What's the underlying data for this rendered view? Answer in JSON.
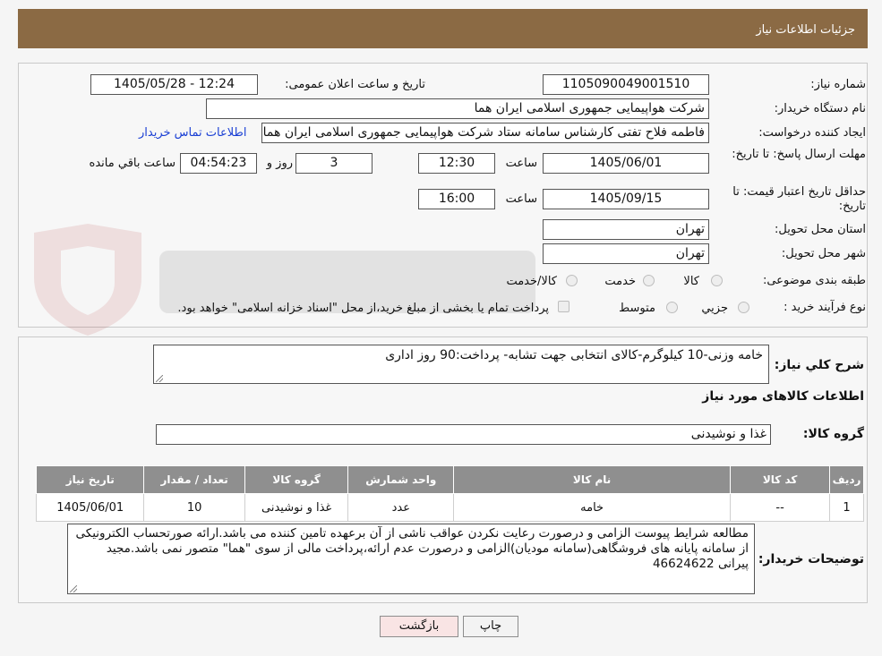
{
  "header": {
    "title": "جزئیات اطلاعات نیاز"
  },
  "form": {
    "need_number_label": "شماره نیاز:",
    "need_number": "1105090049001510",
    "announce_label": "تاریخ و ساعت اعلان عمومی:",
    "announce_value": "1405/05/28 - 12:24",
    "buyer_label": "نام دستگاه خریدار:",
    "buyer": "شرکت هواپیمایی جمهوری اسلامی ایران هما",
    "creator_label": "ایجاد کننده درخواست:",
    "creator": "فاطمه فلاح تفتی کارشناس سامانه ستاد شرکت هواپیمایی جمهوری اسلامی ایران هما",
    "contact_link": "اطلاعات تماس خریدار",
    "deadline_label": "مهلت ارسال پاسخ: تا تاریخ:",
    "deadline_date": "1405/06/01",
    "time_label": "ساعت",
    "deadline_time": "12:30",
    "days": "3",
    "days_label": "روز و",
    "remaining": "04:54:23",
    "remaining_label": "ساعت باقي مانده",
    "validity_label": "حداقل تاریخ اعتبار قیمت: تا تاریخ:",
    "validity_date": "1405/09/15",
    "validity_time": "16:00",
    "province_label": "استان محل تحویل:",
    "province": "تهران",
    "city_label": "شهر محل تحویل:",
    "city": "تهران",
    "category_label": "طبقه بندی موضوعی:",
    "category_options": [
      "کالا",
      "خدمت",
      "کالا/خدمت"
    ],
    "process_label": "نوع فرآیند خرید :",
    "process_options": [
      "جزیي",
      "متوسط"
    ],
    "payment_note": "پرداخت تمام یا بخشی از مبلغ خرید،از محل \"اسناد خزانه اسلامی\" خواهد بود."
  },
  "summary": {
    "label": "شرح كلي نياز:",
    "value": "خامه وزنی-10 کیلوگرم-کالای انتخابی جهت تشابه- پرداخت:90 روز اداری",
    "goods_info_title": "اطلاعات کالاهای مورد نیاز",
    "group_label": "گروه کالا:",
    "group_value": "غذا و نوشیدنی"
  },
  "table": {
    "headers": [
      "رديف",
      "كد كالا",
      "نام كالا",
      "واحد شمارش",
      "گروه كالا",
      "تعداد / مقدار",
      "تاريخ نياز"
    ],
    "rows": [
      [
        "1",
        "--",
        "خامه",
        "عدد",
        "غذا و نوشیدنی",
        "10",
        "1405/06/01"
      ]
    ]
  },
  "notes": {
    "label": "توضیحات خریدار:",
    "value": "مطالعه شرایط پیوست الزامی و درصورت رعایت نکردن عواقب ناشی از آن برعهده تامین کننده می باشد.ارائه صورتحساب الکترونیکی از سامانه پایانه های فروشگاهی(سامانه مودیان)الزامی و درصورت عدم ارائه،پرداخت مالی از سوی \"هما\" متصور نمی باشد.مجید پیرانی 46624622"
  },
  "buttons": {
    "print": "چاپ",
    "back": "بازگشت"
  },
  "colors": {
    "header_bg": "#8b6a44",
    "table_header_bg": "#8f8f8f",
    "link": "#1a3fd4",
    "back_button_bg": "#f9e4e4"
  }
}
